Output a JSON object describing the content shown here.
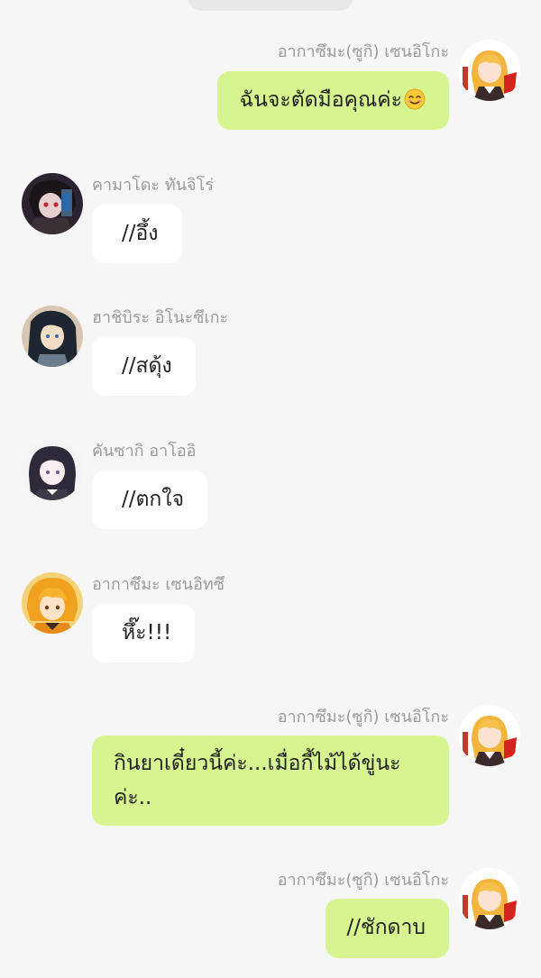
{
  "messages": [
    {
      "side": "right",
      "sender": "อากาซึมะ(ซูกิ) เซนอิโกะ",
      "text": "ฉันจะตัดมือคุณค่ะ",
      "emoji": "smiling-face-emoji",
      "avatar": "avatar-blonde-girl"
    },
    {
      "side": "left",
      "sender": "คามาโดะ ทันจิโร่",
      "text": "//อึ้ง",
      "avatar": "avatar-dark-hair-red-eye"
    },
    {
      "side": "left",
      "sender": "ฮาชิบิระ อิโนะซึเกะ",
      "text": "//สดุ้ง",
      "avatar": "avatar-long-black-hair"
    },
    {
      "side": "left",
      "sender": "คันซากิ อาโออิ",
      "text": "//ตกใจ",
      "avatar": "avatar-pale-girl"
    },
    {
      "side": "left",
      "sender": "อากาซึมะ เซนอิทซึ",
      "text": "หึ๊ะ!!!",
      "avatar": "avatar-blonde-boy"
    },
    {
      "side": "right",
      "sender": "อากาซึมะ(ซูกิ) เซนอิโกะ",
      "text": "กินยาเดี๋ยวนี้ค่ะ...เมื่อกี้ไม้ได้ขู่นะค่ะ..",
      "avatar": "avatar-blonde-girl"
    },
    {
      "side": "right",
      "sender": "อากาซึมะ(ซูกิ) เซนอิโกะ",
      "text": "//ชักดาบ",
      "avatar": "avatar-blonde-girl"
    }
  ],
  "colors": {
    "background": "#f6f6f6",
    "outgoing_bubble": "#d6f591",
    "incoming_bubble": "#ffffff",
    "sender_name": "#9a9a9a"
  }
}
